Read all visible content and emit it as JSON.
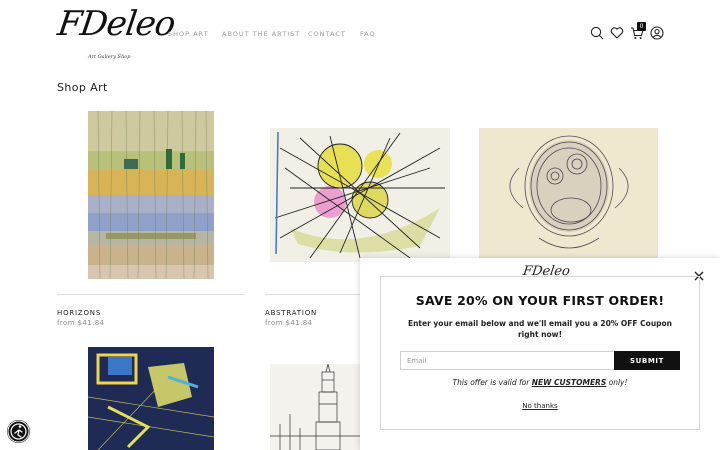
{
  "header": {
    "logo_text": "FDeleo",
    "logo_sub": "Art Gallery Shop",
    "nav": [
      "SHOP ART",
      "ABOUT THE ARTIST",
      "CONTACT",
      "FAQ"
    ],
    "cart_count": "0"
  },
  "page_title": "Shop Art",
  "products": [
    {
      "name": "HORIZONS",
      "price": "from $41.84"
    },
    {
      "name": "ABSTRATION",
      "price": "from $41.84"
    }
  ],
  "popup": {
    "logo_text": "FDeleo",
    "headline": "SAVE 20% ON YOUR FIRST ORDER!",
    "text": "Enter your email below and we'll email you a 20% OFF Coupon right now!",
    "email_placeholder": "Email",
    "submit_label": "SUBMIT",
    "offer_prefix": "This offer is valid for ",
    "offer_highlight": "NEW CUSTOMERS",
    "offer_suffix": " only!",
    "no_thanks": "No thanks"
  },
  "colors": {
    "accent": "#111111",
    "nav_text": "#9a9a9a",
    "price_text": "#888888"
  },
  "icons": [
    "search-icon",
    "heart-icon",
    "cart-icon",
    "user-icon",
    "close-icon",
    "accessibility-icon"
  ]
}
